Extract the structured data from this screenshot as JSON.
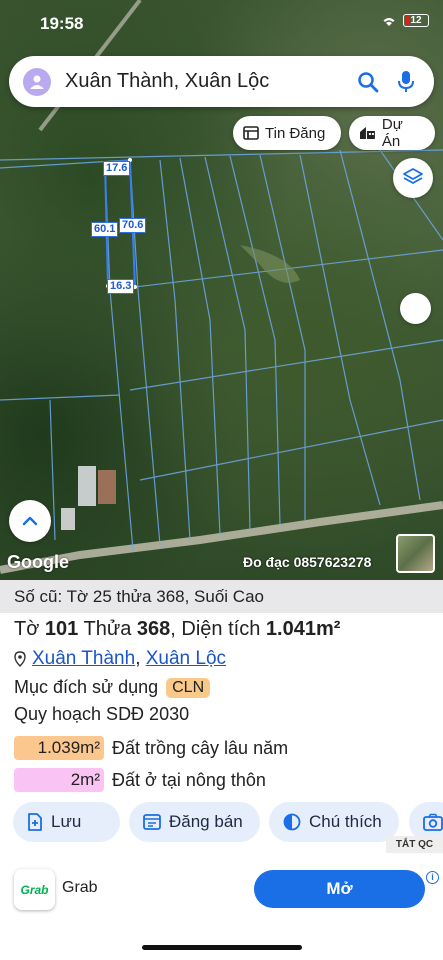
{
  "status_bar": {
    "time": "19:58",
    "battery": "12"
  },
  "search": {
    "value": "Xuân Thành, Xuân Lộc"
  },
  "chips": [
    {
      "label": "Tin Đăng",
      "icon": "listing-icon"
    },
    {
      "label": "Dự Án",
      "icon": "building-icon"
    }
  ],
  "map": {
    "dimensions": [
      "17.6",
      "60.1",
      "70.6",
      "16.3"
    ],
    "google_label": "Google",
    "survey_text": "Đo đạc 0857623278"
  },
  "panel": {
    "old_ref": "Số cũ: Tờ 25 thửa 368, Suối Cao",
    "sheet_prefix": "Tờ",
    "sheet_no": "101",
    "plot_prefix": "Thửa",
    "plot_no": "368",
    "area_prefix": ", Diện tích",
    "area_value": "1.041m²",
    "location_commune": "Xuân Thành",
    "location_sep": ",",
    "location_district": "Xuân Lộc",
    "purpose_label": "Mục đích sử dụng",
    "purpose_code": "CLN",
    "plan_label": "Quy hoạch SDĐ 2030",
    "areas": [
      {
        "value": "1.039m²",
        "label": "Đất trồng cây lâu năm",
        "color": "#fbc78e"
      },
      {
        "value": "2m²",
        "label": "Đất ở tại nông thôn",
        "color": "#f9c4f4"
      }
    ],
    "actions": [
      {
        "label": "Lưu",
        "icon": "save-icon"
      },
      {
        "label": "Đăng bán",
        "icon": "calendar-icon"
      },
      {
        "label": "Chú thích",
        "icon": "contrast-icon"
      },
      {
        "label": "",
        "icon": "camera-icon"
      }
    ]
  },
  "ad": {
    "close_label": "TẮT QC",
    "brand_logo": "Grab",
    "brand_name": "Grab",
    "cta": "Mở",
    "info": "i"
  },
  "colors": {
    "accent": "#1a6ee6",
    "link": "#1a56c8",
    "parcel_line": "#6fa8e8"
  }
}
